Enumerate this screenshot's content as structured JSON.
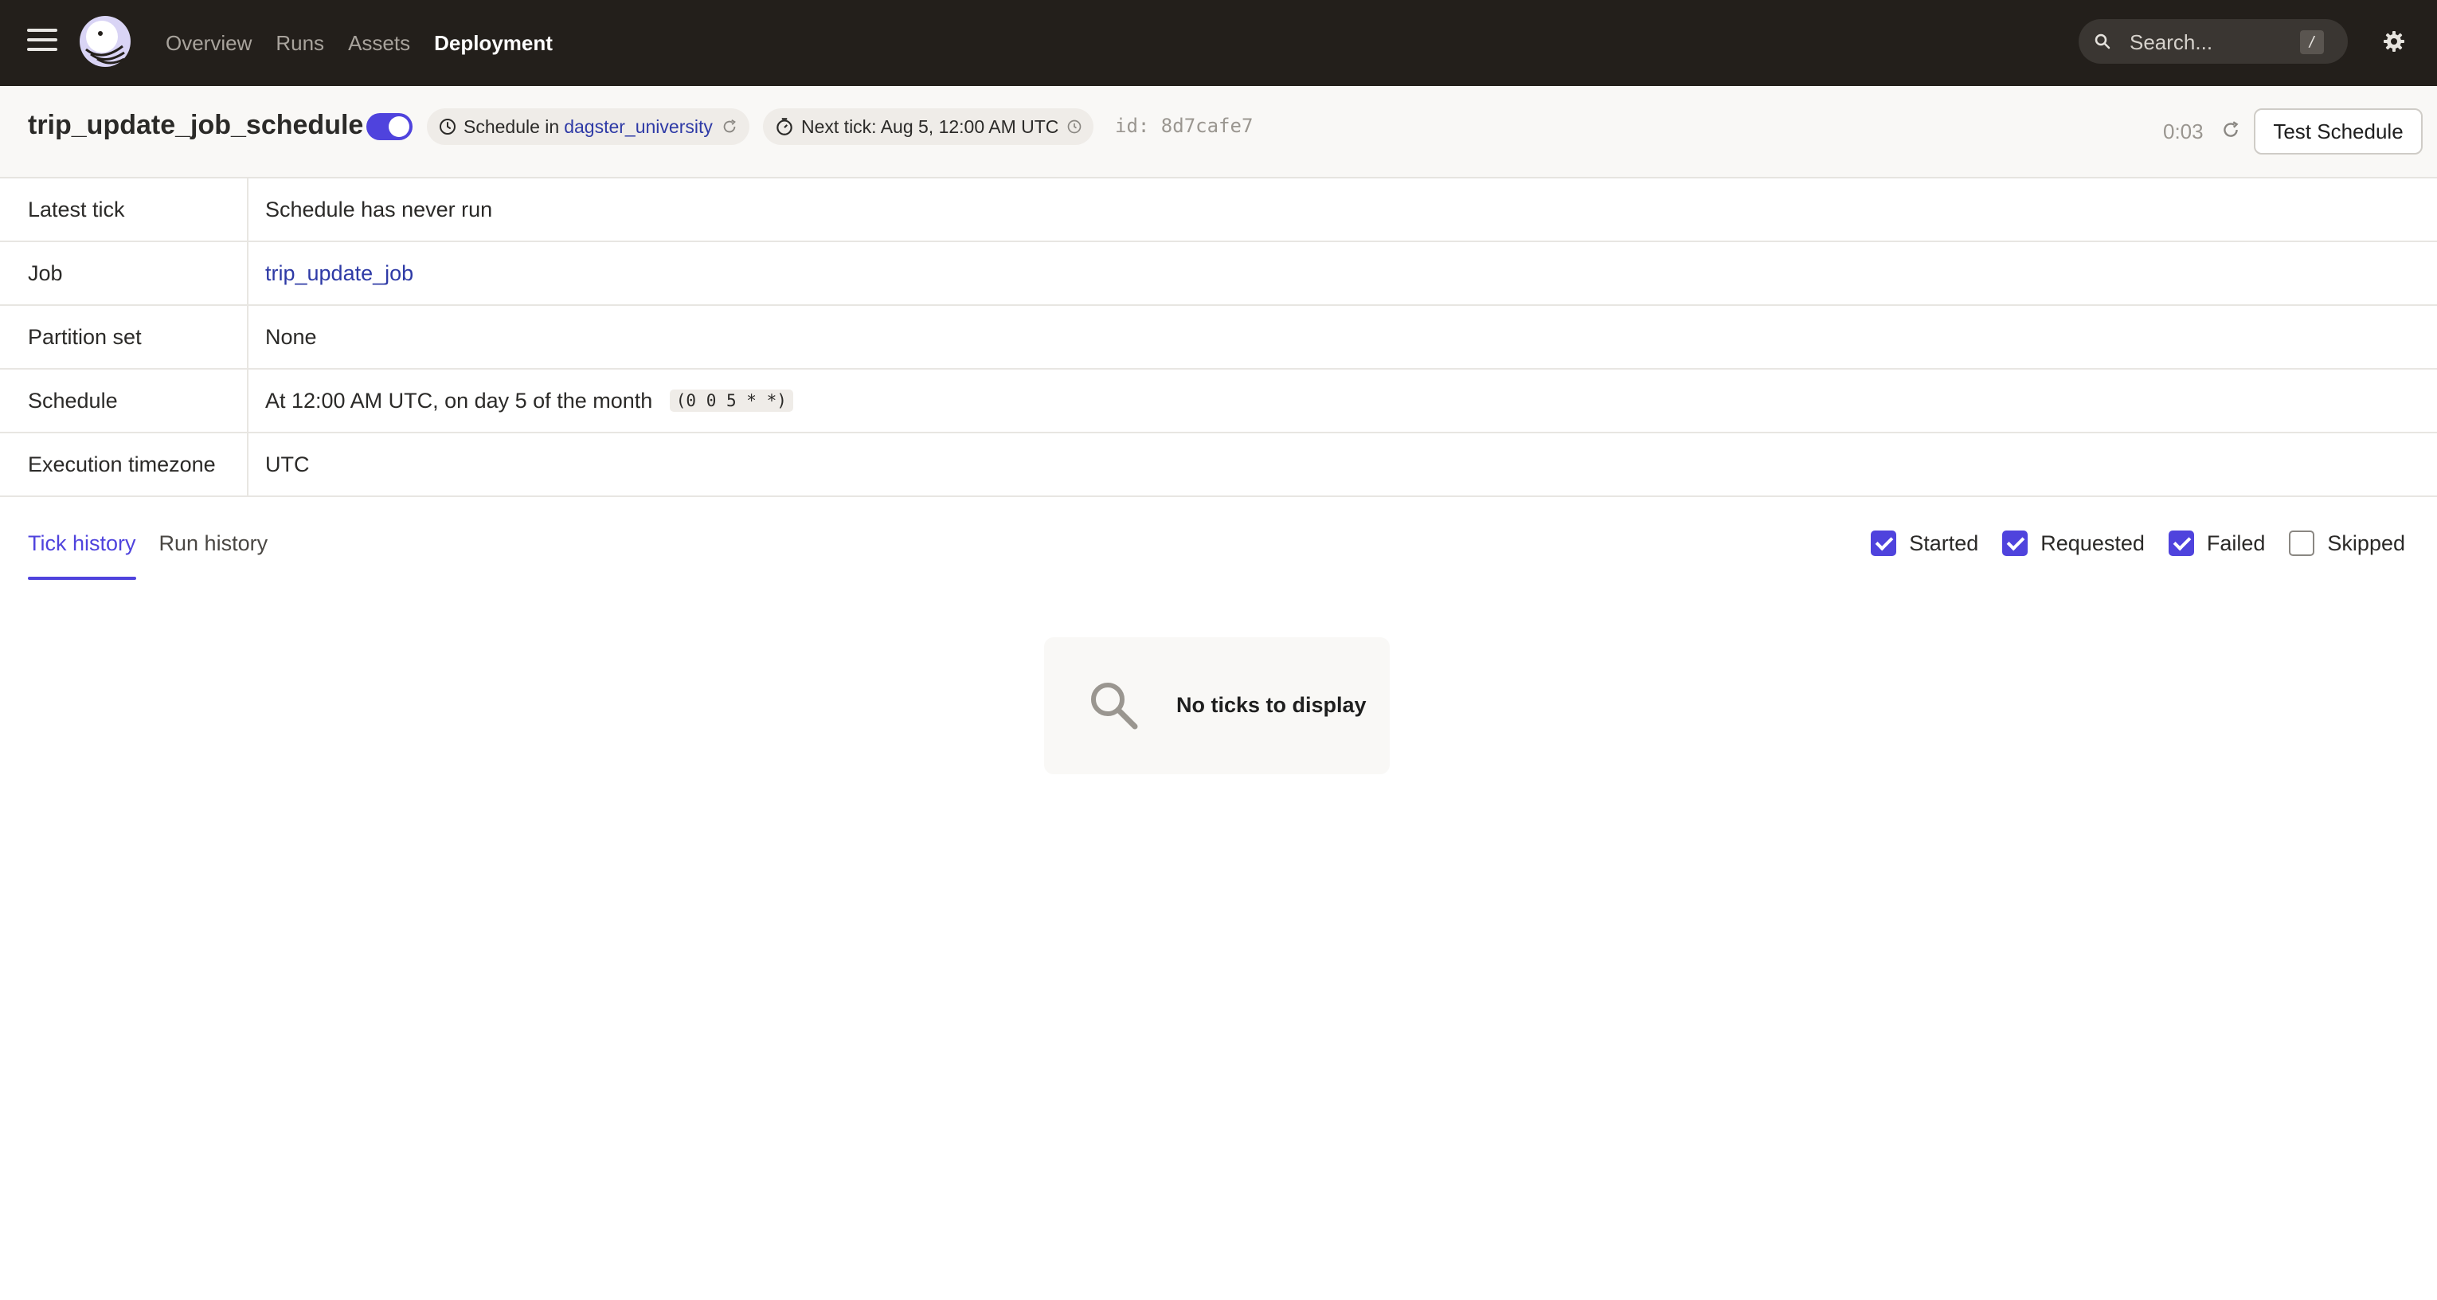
{
  "nav": {
    "links": [
      {
        "label": "Overview",
        "active": false
      },
      {
        "label": "Runs",
        "active": false
      },
      {
        "label": "Assets",
        "active": false
      },
      {
        "label": "Deployment",
        "active": true
      }
    ],
    "search_placeholder": "Search...",
    "search_shortcut": "/",
    "icons": {
      "menu": "hamburger-icon",
      "logo": "dagster-logo",
      "search": "search-icon",
      "settings": "gear-icon"
    }
  },
  "header": {
    "title": "trip_update_job_schedule",
    "toggle_on": true,
    "schedule_prefix": "Schedule in",
    "location_link": "dagster_university",
    "next_tick": "Next tick: Aug 5, 12:00 AM UTC",
    "id_text": "id: 8d7cafe7",
    "timer": "0:03",
    "test_button": "Test Schedule"
  },
  "details": {
    "rows": [
      {
        "key": "Latest tick",
        "value": "Schedule has never run"
      },
      {
        "key": "Job",
        "value": "trip_update_job"
      },
      {
        "key": "Partition set",
        "value": "None"
      },
      {
        "key": "Schedule",
        "value": "At 12:00 AM UTC, on day 5 of the month",
        "cron": "(0 0 5 * *)"
      },
      {
        "key": "Execution timezone",
        "value": "UTC"
      }
    ]
  },
  "tabs": [
    {
      "label": "Tick history",
      "active": true
    },
    {
      "label": "Run history",
      "active": false
    }
  ],
  "filters": [
    {
      "label": "Started",
      "checked": true
    },
    {
      "label": "Requested",
      "checked": true
    },
    {
      "label": "Failed",
      "checked": true
    },
    {
      "label": "Skipped",
      "checked": false
    }
  ],
  "empty_state": {
    "message": "No ticks to display",
    "icon": "search-icon"
  },
  "colors": {
    "nav_bg": "#231f1b",
    "accent": "#4f43dd",
    "link": "#2e3aa6",
    "header_bg": "#f9f8f6"
  }
}
